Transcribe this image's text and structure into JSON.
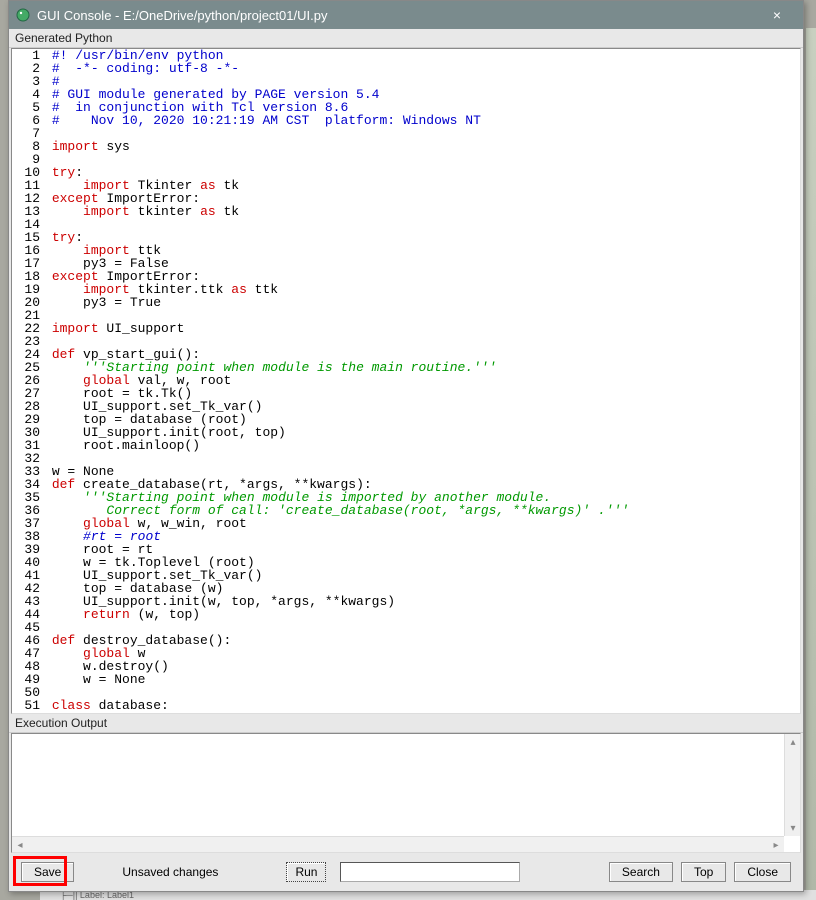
{
  "window": {
    "title": "GUI Console - E:/OneDrive/python/project01/UI.py",
    "close_glyph": "×"
  },
  "sections": {
    "generated_label": "Generated Python",
    "output_label": "Execution Output"
  },
  "code_lines": [
    {
      "n": 1,
      "segs": [
        {
          "t": "#! /usr/bin/env python",
          "c": "comment"
        }
      ]
    },
    {
      "n": 2,
      "segs": [
        {
          "t": "#  -*- coding: utf-8 -*-",
          "c": "comment"
        }
      ]
    },
    {
      "n": 3,
      "segs": [
        {
          "t": "#",
          "c": "comment"
        }
      ]
    },
    {
      "n": 4,
      "segs": [
        {
          "t": "# GUI module generated by PAGE version 5.4",
          "c": "comment"
        }
      ]
    },
    {
      "n": 5,
      "segs": [
        {
          "t": "#  in conjunction with Tcl version 8.6",
          "c": "comment"
        }
      ]
    },
    {
      "n": 6,
      "segs": [
        {
          "t": "#    Nov 10, 2020 10:21:19 AM CST  platform: Windows NT",
          "c": "comment"
        }
      ]
    },
    {
      "n": 7,
      "segs": [
        {
          "t": "",
          "c": "plain"
        }
      ]
    },
    {
      "n": 8,
      "segs": [
        {
          "t": "import",
          "c": "keyword"
        },
        {
          "t": " sys",
          "c": "plain"
        }
      ]
    },
    {
      "n": 9,
      "segs": [
        {
          "t": "",
          "c": "plain"
        }
      ]
    },
    {
      "n": 10,
      "segs": [
        {
          "t": "try",
          "c": "keyword"
        },
        {
          "t": ":",
          "c": "plain"
        }
      ]
    },
    {
      "n": 11,
      "segs": [
        {
          "t": "    ",
          "c": "plain"
        },
        {
          "t": "import",
          "c": "keyword"
        },
        {
          "t": " Tkinter ",
          "c": "plain"
        },
        {
          "t": "as",
          "c": "keyword"
        },
        {
          "t": " tk",
          "c": "plain"
        }
      ]
    },
    {
      "n": 12,
      "segs": [
        {
          "t": "except",
          "c": "keyword"
        },
        {
          "t": " ImportError:",
          "c": "plain"
        }
      ]
    },
    {
      "n": 13,
      "segs": [
        {
          "t": "    ",
          "c": "plain"
        },
        {
          "t": "import",
          "c": "keyword"
        },
        {
          "t": " tkinter ",
          "c": "plain"
        },
        {
          "t": "as",
          "c": "keyword"
        },
        {
          "t": " tk",
          "c": "plain"
        }
      ]
    },
    {
      "n": 14,
      "segs": [
        {
          "t": "",
          "c": "plain"
        }
      ]
    },
    {
      "n": 15,
      "segs": [
        {
          "t": "try",
          "c": "keyword"
        },
        {
          "t": ":",
          "c": "plain"
        }
      ]
    },
    {
      "n": 16,
      "segs": [
        {
          "t": "    ",
          "c": "plain"
        },
        {
          "t": "import",
          "c": "keyword"
        },
        {
          "t": " ttk",
          "c": "plain"
        }
      ]
    },
    {
      "n": 17,
      "segs": [
        {
          "t": "    py3 = False",
          "c": "plain"
        }
      ]
    },
    {
      "n": 18,
      "segs": [
        {
          "t": "except",
          "c": "keyword"
        },
        {
          "t": " ImportError:",
          "c": "plain"
        }
      ]
    },
    {
      "n": 19,
      "segs": [
        {
          "t": "    ",
          "c": "plain"
        },
        {
          "t": "import",
          "c": "keyword"
        },
        {
          "t": " tkinter.ttk ",
          "c": "plain"
        },
        {
          "t": "as",
          "c": "keyword"
        },
        {
          "t": " ttk",
          "c": "plain"
        }
      ]
    },
    {
      "n": 20,
      "segs": [
        {
          "t": "    py3 = True",
          "c": "plain"
        }
      ]
    },
    {
      "n": 21,
      "segs": [
        {
          "t": "",
          "c": "plain"
        }
      ]
    },
    {
      "n": 22,
      "segs": [
        {
          "t": "import",
          "c": "keyword"
        },
        {
          "t": " UI_support",
          "c": "plain"
        }
      ]
    },
    {
      "n": 23,
      "segs": [
        {
          "t": "",
          "c": "plain"
        }
      ]
    },
    {
      "n": 24,
      "segs": [
        {
          "t": "def",
          "c": "keyword"
        },
        {
          "t": " vp_start_gui():",
          "c": "plain"
        }
      ]
    },
    {
      "n": 25,
      "segs": [
        {
          "t": "    ",
          "c": "plain"
        },
        {
          "t": "'''Starting point when module is the main routine.'''",
          "c": "docstr",
          "i": true
        }
      ]
    },
    {
      "n": 26,
      "segs": [
        {
          "t": "    ",
          "c": "plain"
        },
        {
          "t": "global",
          "c": "keyword"
        },
        {
          "t": " val, w, root",
          "c": "plain"
        }
      ]
    },
    {
      "n": 27,
      "segs": [
        {
          "t": "    root = tk.Tk()",
          "c": "plain"
        }
      ]
    },
    {
      "n": 28,
      "segs": [
        {
          "t": "    UI_support.set_Tk_var()",
          "c": "plain"
        }
      ]
    },
    {
      "n": 29,
      "segs": [
        {
          "t": "    top = database (root)",
          "c": "plain"
        }
      ]
    },
    {
      "n": 30,
      "segs": [
        {
          "t": "    UI_support.init(root, top)",
          "c": "plain"
        }
      ]
    },
    {
      "n": 31,
      "segs": [
        {
          "t": "    root.mainloop()",
          "c": "plain"
        }
      ]
    },
    {
      "n": 32,
      "segs": [
        {
          "t": "",
          "c": "plain"
        }
      ]
    },
    {
      "n": 33,
      "segs": [
        {
          "t": "w = None",
          "c": "plain"
        }
      ]
    },
    {
      "n": 34,
      "segs": [
        {
          "t": "def",
          "c": "keyword"
        },
        {
          "t": " create_database(rt, *args, **kwargs):",
          "c": "plain"
        }
      ]
    },
    {
      "n": 35,
      "segs": [
        {
          "t": "    ",
          "c": "plain"
        },
        {
          "t": "'''Starting point when module is imported by another module.",
          "c": "docstr",
          "i": true
        }
      ]
    },
    {
      "n": 36,
      "segs": [
        {
          "t": "       Correct form of call: 'create_database(root, *args, **kwargs)' .'''",
          "c": "docstr",
          "i": true
        }
      ]
    },
    {
      "n": 37,
      "segs": [
        {
          "t": "    ",
          "c": "plain"
        },
        {
          "t": "global",
          "c": "keyword"
        },
        {
          "t": " w, w_win, root",
          "c": "plain"
        }
      ]
    },
    {
      "n": 38,
      "segs": [
        {
          "t": "    ",
          "c": "plain"
        },
        {
          "t": "#rt = root",
          "c": "comment",
          "i": true
        }
      ]
    },
    {
      "n": 39,
      "segs": [
        {
          "t": "    root = rt",
          "c": "plain"
        }
      ]
    },
    {
      "n": 40,
      "segs": [
        {
          "t": "    w = tk.Toplevel (root)",
          "c": "plain"
        }
      ]
    },
    {
      "n": 41,
      "segs": [
        {
          "t": "    UI_support.set_Tk_var()",
          "c": "plain"
        }
      ]
    },
    {
      "n": 42,
      "segs": [
        {
          "t": "    top = database (w)",
          "c": "plain"
        }
      ]
    },
    {
      "n": 43,
      "segs": [
        {
          "t": "    UI_support.init(w, top, *args, **kwargs)",
          "c": "plain"
        }
      ]
    },
    {
      "n": 44,
      "segs": [
        {
          "t": "    ",
          "c": "plain"
        },
        {
          "t": "return",
          "c": "keyword"
        },
        {
          "t": " (w, top)",
          "c": "plain"
        }
      ]
    },
    {
      "n": 45,
      "segs": [
        {
          "t": "",
          "c": "plain"
        }
      ]
    },
    {
      "n": 46,
      "segs": [
        {
          "t": "def",
          "c": "keyword"
        },
        {
          "t": " destroy_database():",
          "c": "plain"
        }
      ]
    },
    {
      "n": 47,
      "segs": [
        {
          "t": "    ",
          "c": "plain"
        },
        {
          "t": "global",
          "c": "keyword"
        },
        {
          "t": " w",
          "c": "plain"
        }
      ]
    },
    {
      "n": 48,
      "segs": [
        {
          "t": "    w.destroy()",
          "c": "plain"
        }
      ]
    },
    {
      "n": 49,
      "segs": [
        {
          "t": "    w = None",
          "c": "plain"
        }
      ]
    },
    {
      "n": 50,
      "segs": [
        {
          "t": "",
          "c": "plain"
        }
      ]
    },
    {
      "n": 51,
      "segs": [
        {
          "t": "class",
          "c": "keyword"
        },
        {
          "t": " database:",
          "c": "plain"
        }
      ]
    }
  ],
  "status": {
    "unsaved": "Unsaved changes"
  },
  "buttons": {
    "save": "Save",
    "run": "Run",
    "search": "Search",
    "top": "Top",
    "close": "Close"
  },
  "bg_hint": "├─||  Label: Label1"
}
